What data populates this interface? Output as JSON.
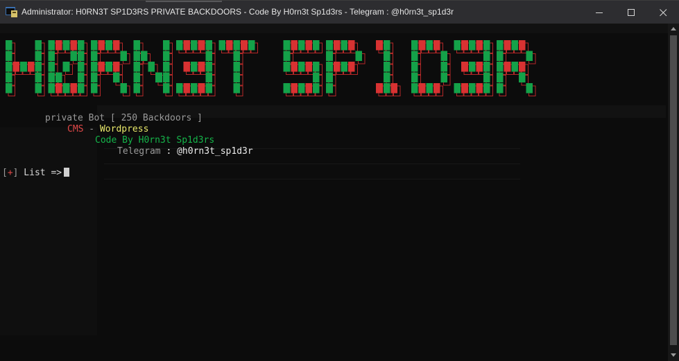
{
  "window": {
    "title": "Administrator:  H0RN3T SP1D3RS PRIVATE BACKDOORS - Code By H0rn3t Sp1d3rs - Telegram : @h0rn3t_sp1d3r",
    "minimize": "minimize-icon",
    "maximize": "maximize-icon",
    "close": "close-icon"
  },
  "banner": {
    "text": "H0RN3T SP1D3R",
    "colors": {
      "green": "#14a149",
      "red": "#d83232",
      "outline": "#b42828"
    }
  },
  "console": {
    "line1": "private Bot [ 250 Backdoors ]",
    "cms_label": "CMS",
    "cms_sep": " - ",
    "cms_value": "Wordpress",
    "credit": "Code By H0rn3t Sp1d3rs",
    "telegram_label": "Telegram",
    "telegram_sep": " : ",
    "telegram_value": "@h0rn3t_sp1d3r",
    "prompt_bracket_open": "[",
    "prompt_symbol": "+",
    "prompt_bracket_close": "]",
    "prompt_text": " List =>"
  },
  "colors": {
    "terminal_bg": "#0c0c0c",
    "titlebar_bg": "#2d2d30"
  }
}
